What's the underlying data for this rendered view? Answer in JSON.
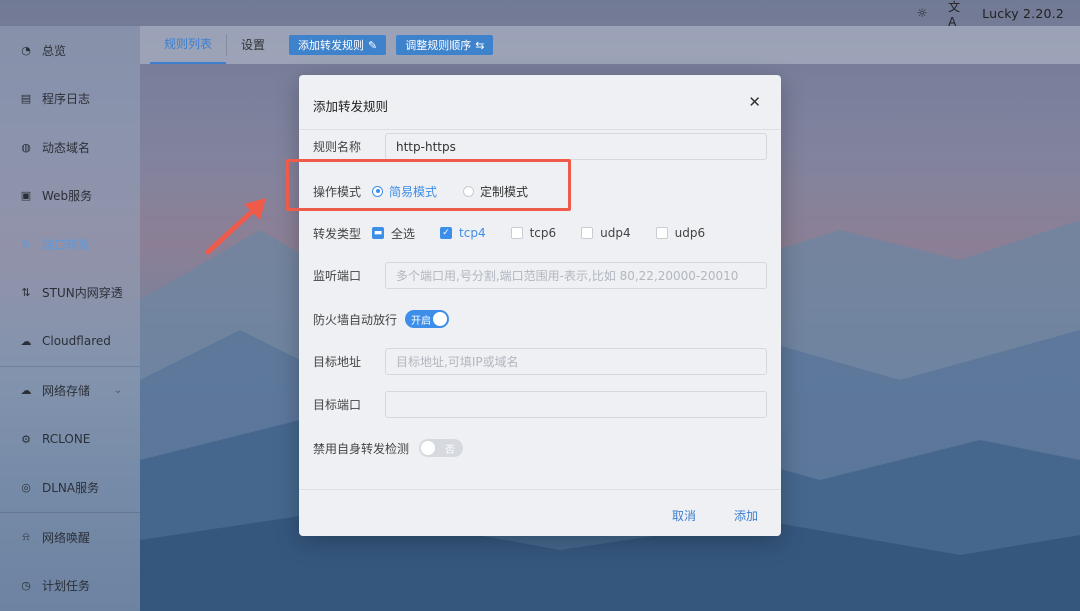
{
  "app": {
    "version": "Lucky 2.20.2",
    "icons": [
      "sun-icon",
      "translate-icon"
    ]
  },
  "sidebar": {
    "items": [
      {
        "label": "总览",
        "icon": "dashboard-icon"
      },
      {
        "label": "程序日志",
        "icon": "log-icon"
      },
      {
        "label": "动态域名",
        "icon": "dns-icon"
      },
      {
        "label": "Web服务",
        "icon": "web-icon"
      },
      {
        "label": "端口转发",
        "icon": "port-forward-icon",
        "active": true
      },
      {
        "label": "STUN内网穿透",
        "icon": "stun-icon"
      },
      {
        "label": "Cloudflared",
        "icon": "cloud-icon"
      },
      {
        "label": "网络存储",
        "icon": "storage-icon",
        "expandable": true
      },
      {
        "label": "RCLONE",
        "icon": "rclone-icon"
      },
      {
        "label": "DLNA服务",
        "icon": "dlna-icon"
      },
      {
        "label": "网络唤醒",
        "icon": "bell-icon"
      },
      {
        "label": "计划任务",
        "icon": "clock-icon"
      }
    ]
  },
  "tabs": [
    {
      "label": "规则列表",
      "active": true
    },
    {
      "label": "设置"
    }
  ],
  "toolbar": {
    "add_rule": "添加转发规则",
    "reorder": "调整规则顺序"
  },
  "modal": {
    "title": "添加转发规则",
    "fields": {
      "rule_name": {
        "label": "规则名称",
        "value": "http-https"
      },
      "mode": {
        "label": "操作模式",
        "options": [
          {
            "label": "简易模式",
            "selected": true
          },
          {
            "label": "定制模式",
            "selected": false
          }
        ]
      },
      "forward_type": {
        "label": "转发类型",
        "options": [
          {
            "label": "全选",
            "state": "indeterminate"
          },
          {
            "label": "tcp4",
            "state": "checked"
          },
          {
            "label": "tcp6",
            "state": "unchecked"
          },
          {
            "label": "udp4",
            "state": "unchecked"
          },
          {
            "label": "udp6",
            "state": "unchecked"
          }
        ]
      },
      "listen_port": {
        "label": "监听端口",
        "placeholder": "多个端口用,号分割,端口范围用-表示,比如 80,22,20000-20010"
      },
      "firewall": {
        "label": "防火墙自动放行",
        "toggle_text": "开启",
        "on": true
      },
      "target_addr": {
        "label": "目标地址",
        "placeholder": "目标地址,可填IP或域名"
      },
      "target_port": {
        "label": "目标端口",
        "placeholder": ""
      },
      "disable_self_check": {
        "label": "禁用自身转发检测",
        "toggle_text": "否",
        "on": false
      }
    },
    "cancel": "取消",
    "confirm": "添加"
  },
  "colors": {
    "accent": "#3d8ee8",
    "annotation": "#ee5b4b"
  }
}
